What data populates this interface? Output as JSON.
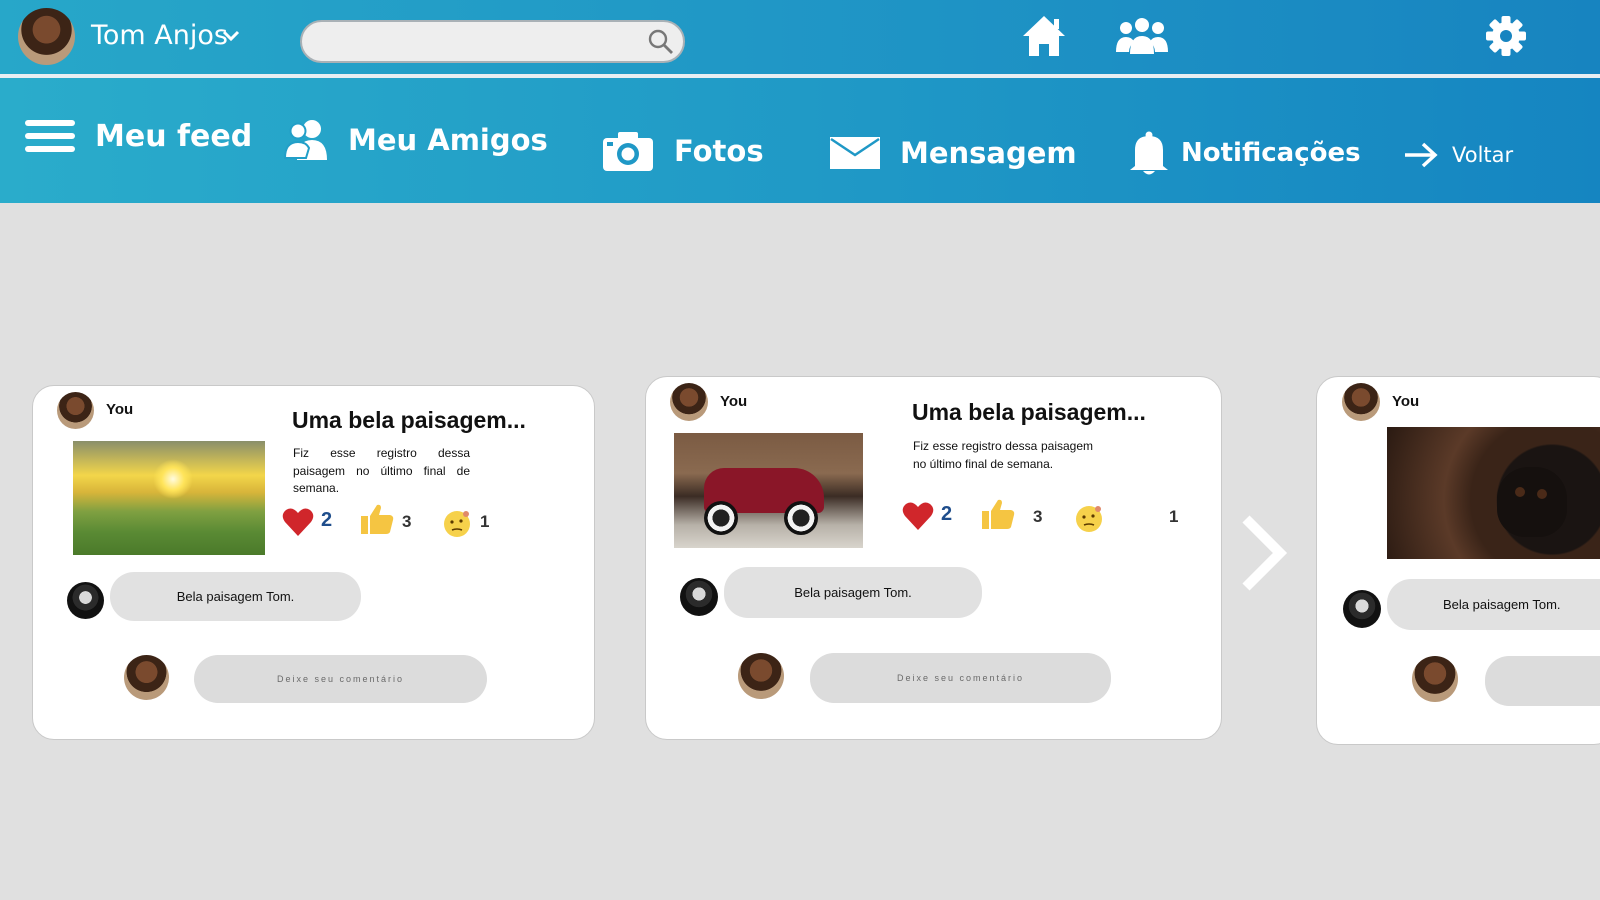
{
  "header": {
    "user_name": "Tom Anjos",
    "search_placeholder": ""
  },
  "nav": {
    "feed": "Meu feed",
    "friends": "Meu Amigos",
    "photos": "Fotos",
    "messages": "Mensagem",
    "notifications": "Notificações",
    "back": "Voltar"
  },
  "posts": [
    {
      "author": "You",
      "title": "Uma bela paisagem...",
      "body": "Fiz esse registro dessa paisagem no último final de semana.",
      "hearts": "2",
      "likes": "3",
      "thinking": "1",
      "comment": "Bela paisagem Tom.",
      "comment_placeholder": "Deixe seu comentário"
    },
    {
      "author": "You",
      "title": "Uma bela paisagem...",
      "body": "Fiz esse registro dessa paisagem no último final de semana.",
      "hearts": "2",
      "likes": "3",
      "thinking": "1",
      "comment": "Bela paisagem Tom.",
      "comment_placeholder": "Deixe seu comentário"
    },
    {
      "author": "You",
      "comment": "Bela paisagem Tom."
    }
  ],
  "colors": {
    "header_start": "#27a7c9",
    "header_end": "#1784c0",
    "heart": "#d0262b",
    "like": "#f5c542",
    "count_blue": "#1f4e8c",
    "background": "#e0e0e0"
  }
}
